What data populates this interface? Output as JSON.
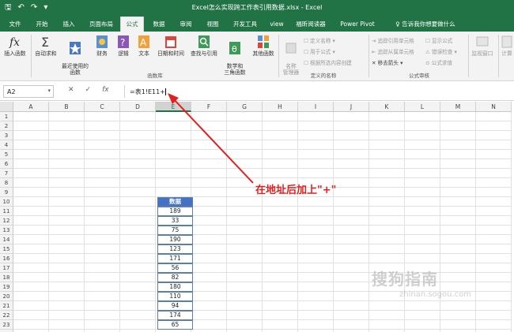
{
  "window": {
    "title": "Excel怎么实现跨工作表引用数据.xlsx  -  Excel"
  },
  "qat": {
    "save": "🖫",
    "undo": "↶",
    "redo": "↷",
    "more": "▾"
  },
  "tabs": [
    "文件",
    "开始",
    "插入",
    "页面布局",
    "公式",
    "数据",
    "审阅",
    "视图",
    "开发工具",
    "view",
    "福昕阅读器",
    "Power Pivot"
  ],
  "active_tab": "公式",
  "tell_me": "♀ 告诉我你想要做什么",
  "ribbon": {
    "buttons": [
      {
        "label": "插入函数",
        "icon": "fx-icon"
      },
      {
        "label": "自动求和",
        "icon": "sigma-icon"
      },
      {
        "label": "最近使用的\n函数",
        "icon": "star-icon"
      },
      {
        "label": "财务",
        "icon": "finance-icon"
      },
      {
        "label": "逻辑",
        "icon": "logic-icon"
      },
      {
        "label": "文本",
        "icon": "text-icon"
      },
      {
        "label": "日期和时间",
        "icon": "calendar-icon"
      },
      {
        "label": "查找与引用",
        "icon": "lookup-icon"
      },
      {
        "label": "数学和\n三角函数",
        "icon": "math-icon"
      },
      {
        "label": "其他函数",
        "icon": "more-functions-icon"
      }
    ],
    "group_function_library": "函数库",
    "name_manager": "名称\n管理器",
    "define_name": "☐ 定义名称 ▾",
    "use_in_formula": "☐ 用于公式 ▾",
    "create_from_selection": "☐ 根据所选内容创建",
    "group_defined_names": "定义的名称",
    "trace_precedents": "⇥ 追踪引用单元格",
    "trace_dependents": "⇤ 追踪从属单元格",
    "remove_arrows": "✕ 移去箭头 ▾",
    "show_formulas": "☐ 显示公式",
    "error_checking": "⚠ 错误检查 ▾",
    "evaluate_formula": "⊙ 公式求值",
    "group_formula_auditing": "公式审核",
    "watch_window": "监视窗口",
    "calc": "计算"
  },
  "formula_bar": {
    "name_box": "A2",
    "cancel": "✕",
    "enter": "✓",
    "fx": "fx",
    "formula": "=表1!E11+"
  },
  "columns": [
    "A",
    "B",
    "C",
    "D",
    "E",
    "F",
    "G",
    "H",
    "I",
    "J",
    "K",
    "L",
    "M",
    "N"
  ],
  "rows": [
    "1",
    "2",
    "3",
    "4",
    "5",
    "6",
    "7",
    "8",
    "9",
    "10",
    "11",
    "12",
    "13",
    "14",
    "15",
    "16",
    "17",
    "18",
    "19",
    "20",
    "21",
    "22",
    "23",
    "24"
  ],
  "table": {
    "header": "数据",
    "values": [
      "189",
      "33",
      "75",
      "190",
      "123",
      "171",
      "56",
      "82",
      "180",
      "110",
      "94",
      "174",
      "65"
    ]
  },
  "annotation": "在地址后加上\"+\"",
  "watermark": {
    "line1": "搜狗指南",
    "line2": "zhinan.sogou.com"
  }
}
